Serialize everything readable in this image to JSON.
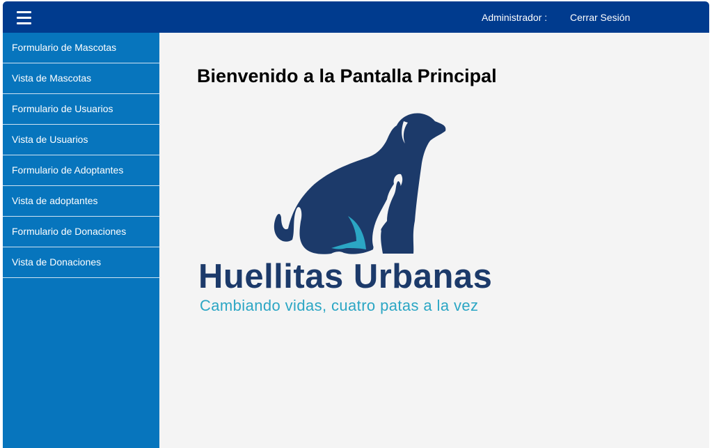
{
  "header": {
    "admin_label": "Administrador :",
    "logout_label": "Cerrar Sesión"
  },
  "sidebar": {
    "items": [
      {
        "label": "Formulario de Mascotas"
      },
      {
        "label": "Vista de Mascotas"
      },
      {
        "label": "Formulario de Usuarios"
      },
      {
        "label": "Vista de Usuarios"
      },
      {
        "label": "Formulario de Adoptantes"
      },
      {
        "label": "Vista de adoptantes"
      },
      {
        "label": "Formulario de Donaciones"
      },
      {
        "label": "Vista de Donaciones"
      }
    ]
  },
  "main": {
    "title": "Bienvenido a la Pantalla Principal",
    "brand_name": "Huellitas Urbanas",
    "tagline": "Cambiando vidas, cuatro patas a la vez"
  },
  "colors": {
    "topbar": "#003b8e",
    "sidebar": "#0775bd",
    "content_bg": "#f4f4f4",
    "logo_navy": "#1c3a6a",
    "logo_teal": "#2ba6c4"
  }
}
